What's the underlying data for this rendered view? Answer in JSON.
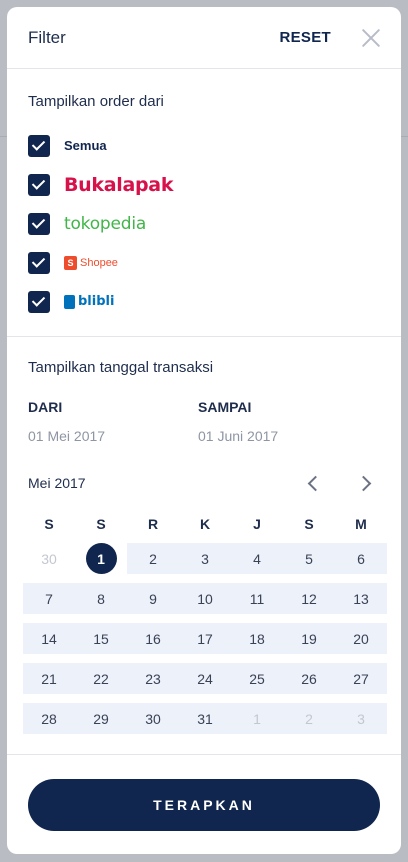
{
  "header": {
    "title": "Filter",
    "reset_label": "RESET"
  },
  "sources": {
    "title": "Tampilkan order dari",
    "items": [
      {
        "label": "Semua",
        "checked": true
      },
      {
        "label": "Bukalapak",
        "checked": true
      },
      {
        "label": "tokopedia",
        "checked": true
      },
      {
        "label": "Shopee",
        "checked": true
      },
      {
        "label": "blibli",
        "checked": true
      }
    ]
  },
  "dates": {
    "title": "Tampilkan tanggal transaksi",
    "from_label": "DARI",
    "from_value": "01 Mei 2017",
    "to_label": "SAMPAI",
    "to_value": "01 Juni 2017"
  },
  "calendar": {
    "month": "Mei 2017",
    "weekdays": [
      "S",
      "S",
      "R",
      "K",
      "J",
      "S",
      "M"
    ],
    "weeks": [
      [
        "30",
        "1",
        "2",
        "3",
        "4",
        "5",
        "6"
      ],
      [
        "7",
        "8",
        "9",
        "10",
        "11",
        "12",
        "13"
      ],
      [
        "14",
        "15",
        "16",
        "17",
        "18",
        "19",
        "20"
      ],
      [
        "21",
        "22",
        "23",
        "24",
        "25",
        "26",
        "27"
      ],
      [
        "28",
        "29",
        "30",
        "31",
        "1",
        "2",
        "3"
      ]
    ],
    "selected": "1"
  },
  "footer": {
    "apply_label": "TERAPKAN"
  },
  "colors": {
    "primary": "#10264f",
    "bukalapak": "#d71149",
    "tokopedia": "#42b549",
    "shopee": "#ee4d2d",
    "blibli": "#0072bc"
  }
}
